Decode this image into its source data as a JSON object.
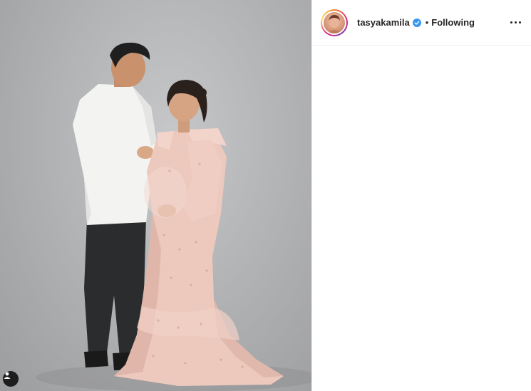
{
  "header": {
    "username": "tasyakamila",
    "separator": "•",
    "follow_status": "Following"
  },
  "icons": {
    "verified": "verified-badge-icon",
    "more": "more-options-icon",
    "tag": "user-tag-icon"
  },
  "colors": {
    "verified_blue": "#3897f0",
    "text": "#262626",
    "border": "#efefef"
  }
}
